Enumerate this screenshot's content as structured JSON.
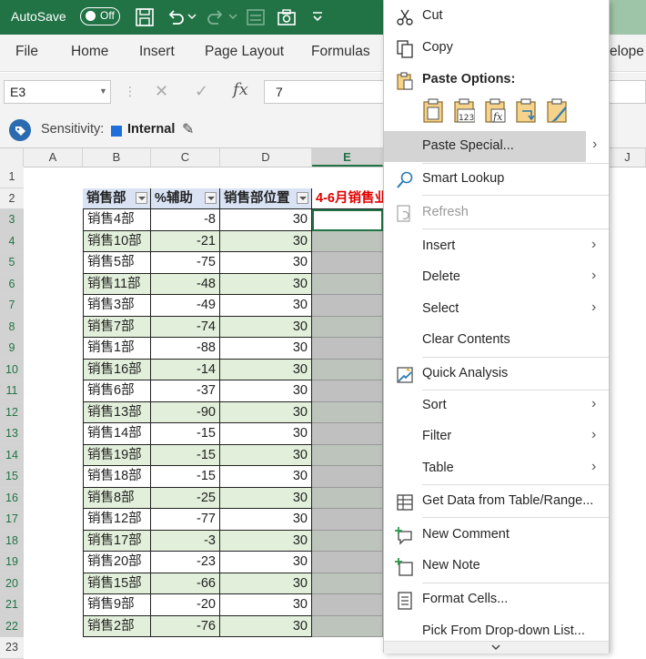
{
  "title_bar": {
    "autosave_label": "AutoSave",
    "autosave_state": "Off"
  },
  "ribbon": {
    "tabs": [
      "File",
      "Home",
      "Insert",
      "Page Layout",
      "Formulas",
      "elope"
    ]
  },
  "formula_bar": {
    "name_box": "E3",
    "fx": "fx",
    "value": "7"
  },
  "sensitivity": {
    "label": "Sensitivity:",
    "value": "Internal"
  },
  "columns": [
    "A",
    "B",
    "C",
    "D",
    "E",
    "J"
  ],
  "rows": [
    "1",
    "2",
    "3",
    "4",
    "5",
    "6",
    "7",
    "8",
    "9",
    "10",
    "11",
    "12",
    "13",
    "14",
    "15",
    "16",
    "17",
    "18",
    "19",
    "20",
    "21",
    "22",
    "23"
  ],
  "table": {
    "headers": [
      "销售部",
      "%辅助",
      "销售部位置",
      "4-6月销售业"
    ],
    "rows": [
      [
        "销售4部",
        "-8",
        "30"
      ],
      [
        "销售10部",
        "-21",
        "30"
      ],
      [
        "销售5部",
        "-75",
        "30"
      ],
      [
        "销售11部",
        "-48",
        "30"
      ],
      [
        "销售3部",
        "-49",
        "30"
      ],
      [
        "销售7部",
        "-74",
        "30"
      ],
      [
        "销售1部",
        "-88",
        "30"
      ],
      [
        "销售16部",
        "-14",
        "30"
      ],
      [
        "销售6部",
        "-37",
        "30"
      ],
      [
        "销售13部",
        "-90",
        "30"
      ],
      [
        "销售14部",
        "-15",
        "30"
      ],
      [
        "销售19部",
        "-15",
        "30"
      ],
      [
        "销售18部",
        "-15",
        "30"
      ],
      [
        "销售8部",
        "-25",
        "30"
      ],
      [
        "销售12部",
        "-77",
        "30"
      ],
      [
        "销售17部",
        "-3",
        "30"
      ],
      [
        "销售20部",
        "-23",
        "30"
      ],
      [
        "销售15部",
        "-66",
        "30"
      ],
      [
        "销售9部",
        "-20",
        "30"
      ],
      [
        "销售2部",
        "-76",
        "30"
      ]
    ]
  },
  "context_menu": {
    "cut": "Cut",
    "copy": "Copy",
    "paste_options": "Paste Options:",
    "paste_special": "Paste Special...",
    "smart_lookup": "Smart Lookup",
    "refresh": "Refresh",
    "insert": "Insert",
    "delete": "Delete",
    "select": "Select",
    "clear_contents": "Clear Contents",
    "quick_analysis": "Quick Analysis",
    "sort": "Sort",
    "filter": "Filter",
    "table": "Table",
    "get_data": "Get Data from Table/Range...",
    "new_comment": "New Comment",
    "new_note": "New Note",
    "format_cells": "Format Cells...",
    "pick_list": "Pick From Drop-down List..."
  },
  "colors": {
    "title_green": "#217346",
    "band_green": "#e2efda",
    "band_blue": "#d9e3f4",
    "header_red": "#e00000",
    "selected_gray": "#c0c0c0"
  }
}
